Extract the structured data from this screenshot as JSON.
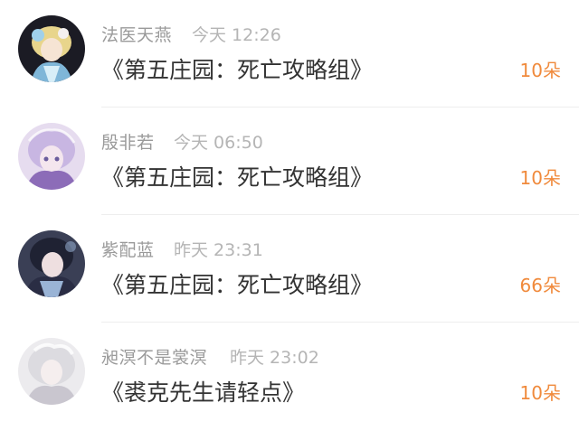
{
  "items": [
    {
      "name": "法医天燕",
      "time": "今天 12:26",
      "title": "《第五庄园：死亡攻略组》",
      "count": "10朵"
    },
    {
      "name": "殷非若",
      "time": "今天 06:50",
      "title": "《第五庄园：死亡攻略组》",
      "count": "10朵"
    },
    {
      "name": "紫配蓝",
      "time": "昨天 23:31",
      "title": "《第五庄园：死亡攻略组》",
      "count": "66朵"
    },
    {
      "name": "昶溟不是裳溟",
      "time": "昨天 23:02",
      "title": "《裘克先生请轻点》",
      "count": "10朵"
    }
  ],
  "colors": {
    "accent": "#f08a3c",
    "name_text": "#9a9a9a",
    "time_text": "#b5b5b5",
    "title_text": "#333333"
  }
}
